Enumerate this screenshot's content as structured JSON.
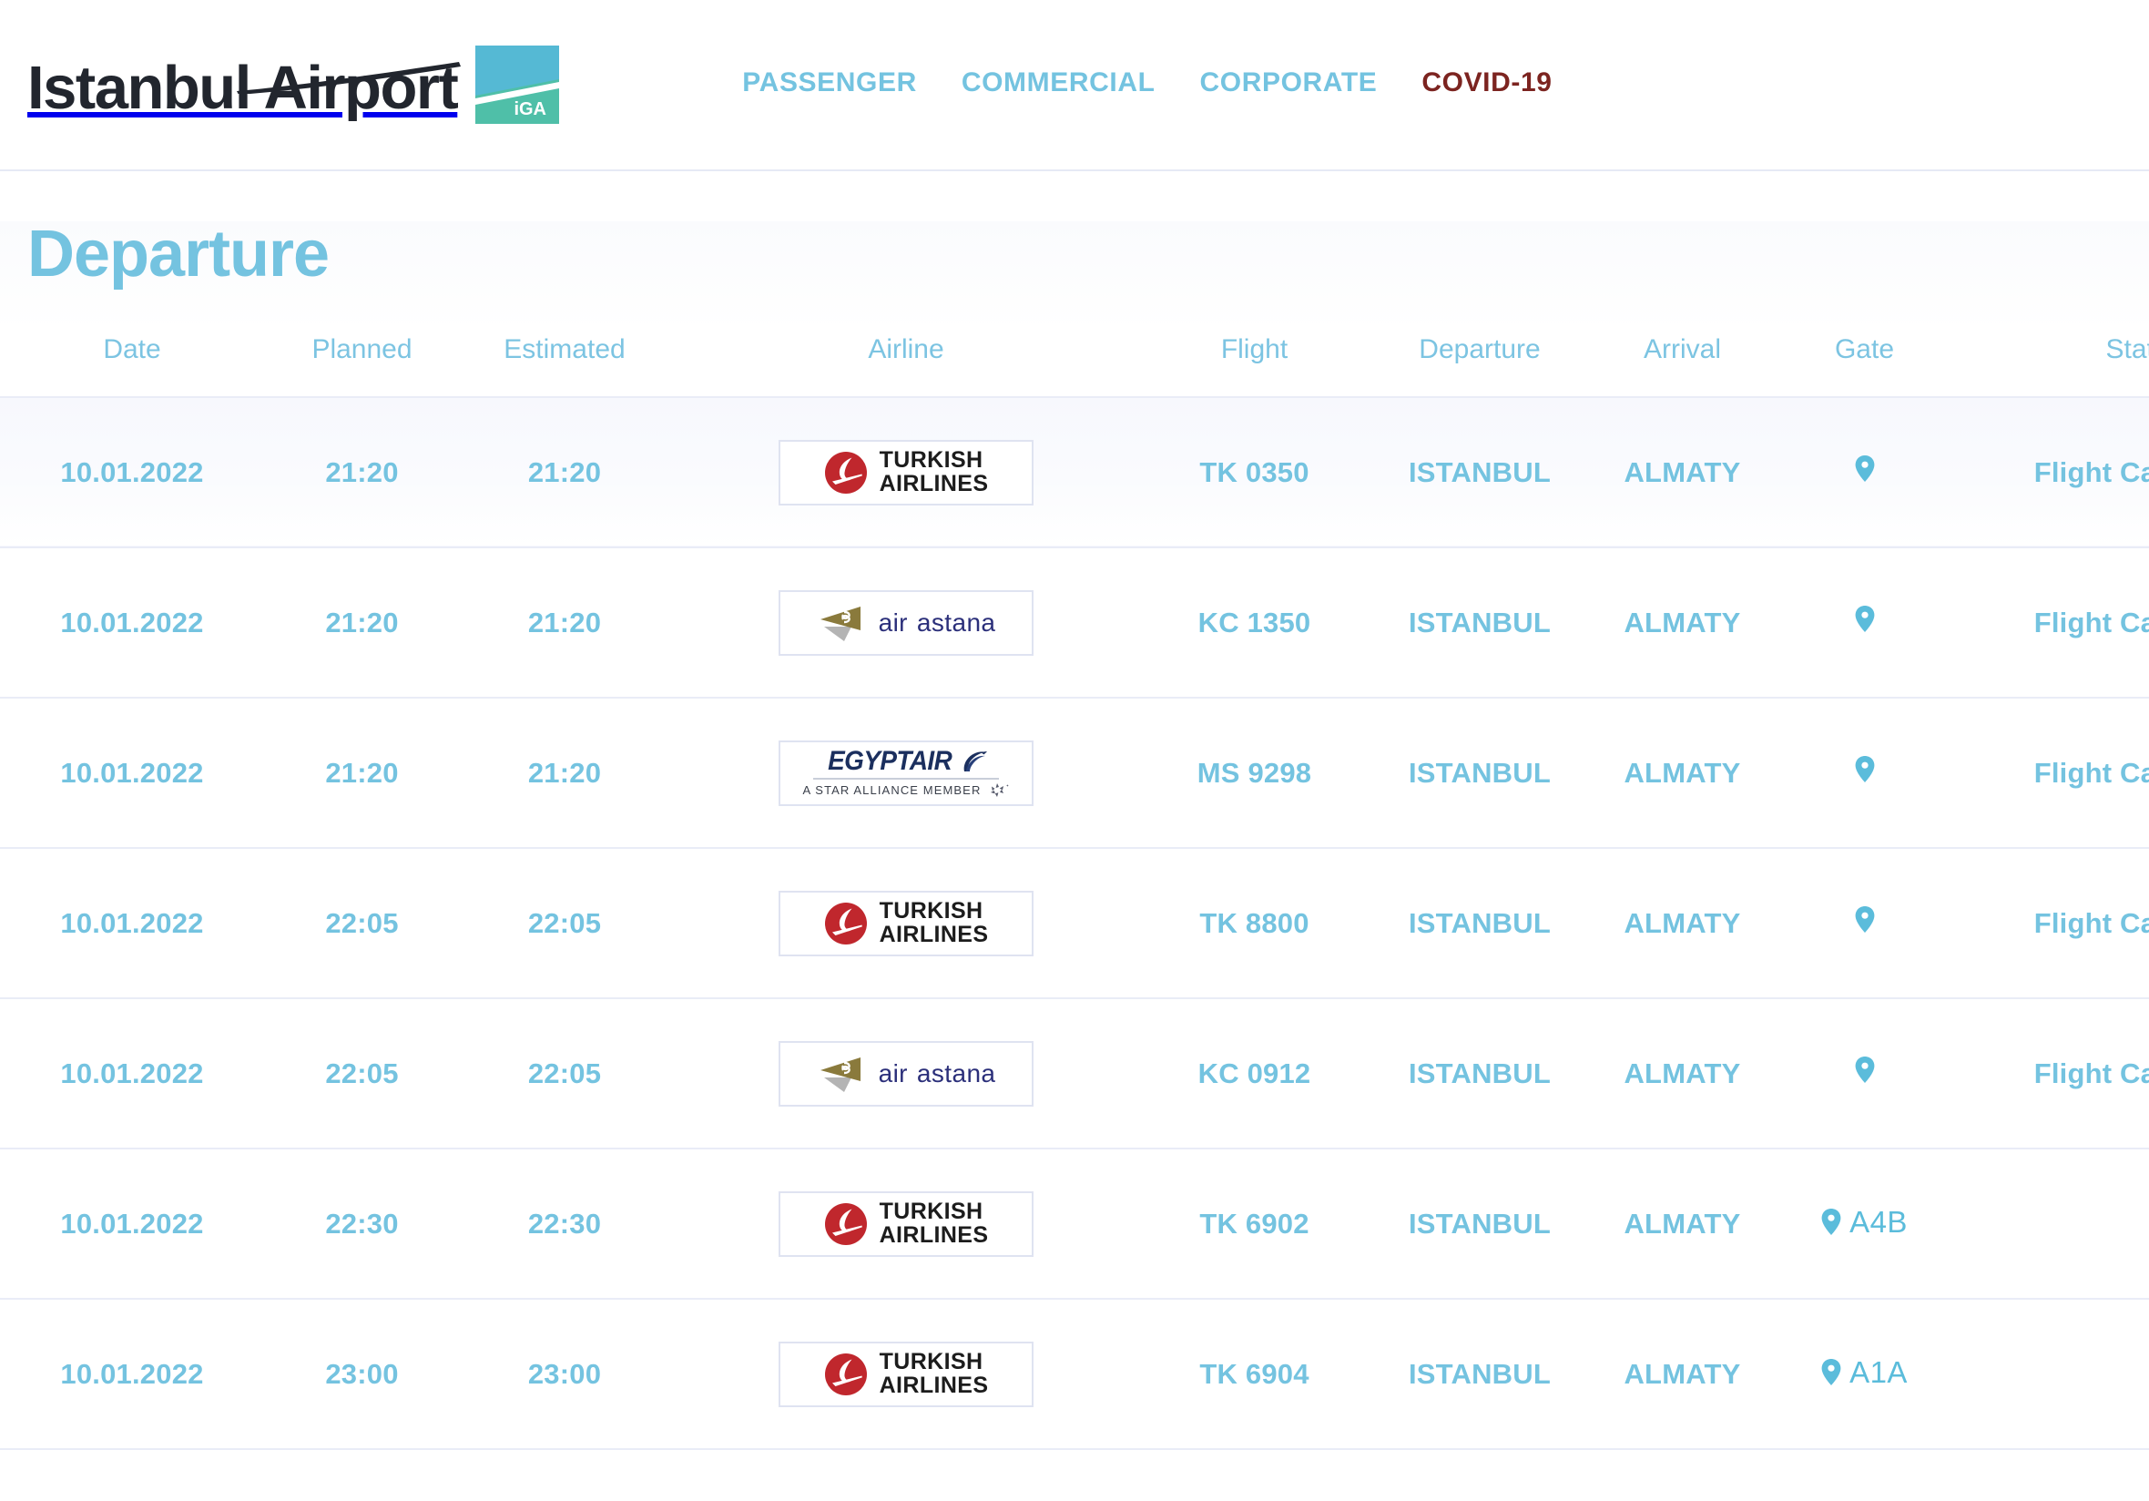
{
  "header": {
    "brand_name": "Istanbul Airport",
    "brand_mark_label": "iGA",
    "nav": [
      {
        "label": "PASSENGER",
        "name": "nav-passenger",
        "variant": "default"
      },
      {
        "label": "COMMERCIAL",
        "name": "nav-commercial",
        "variant": "default"
      },
      {
        "label": "CORPORATE",
        "name": "nav-corporate",
        "variant": "default"
      },
      {
        "label": "COVID-19",
        "name": "nav-covid-19",
        "variant": "covid"
      }
    ]
  },
  "page": {
    "title": "Departure"
  },
  "table": {
    "columns": [
      {
        "label": "Date",
        "key": "date"
      },
      {
        "label": "Planned",
        "key": "planned"
      },
      {
        "label": "Estimated",
        "key": "estimated"
      },
      {
        "label": "Airline",
        "key": "airline"
      },
      {
        "label": "Flight",
        "key": "flight"
      },
      {
        "label": "Departure",
        "key": "departure"
      },
      {
        "label": "Arrival",
        "key": "arrival"
      },
      {
        "label": "Gate",
        "key": "gate"
      },
      {
        "label": "Status",
        "key": "status"
      }
    ],
    "rows": [
      {
        "date": "10.01.2022",
        "planned": "21:20",
        "estimated": "21:20",
        "airline": "Turkish Airlines",
        "airline_logo": "turkish-airlines-logo",
        "flight": "TK 0350",
        "departure": "ISTANBUL",
        "arrival": "ALMATY",
        "gate": "",
        "status": "Flight Cancelled",
        "highlighted": true
      },
      {
        "date": "10.01.2022",
        "planned": "21:20",
        "estimated": "21:20",
        "airline": "Air Astana",
        "airline_logo": "air-astana-logo",
        "flight": "KC 1350",
        "departure": "ISTANBUL",
        "arrival": "ALMATY",
        "gate": "",
        "status": "Flight Cancelled",
        "highlighted": false
      },
      {
        "date": "10.01.2022",
        "planned": "21:20",
        "estimated": "21:20",
        "airline": "EgyptAir",
        "airline_logo": "egyptair-logo",
        "flight": "MS 9298",
        "departure": "ISTANBUL",
        "arrival": "ALMATY",
        "gate": "",
        "status": "Flight Cancelled",
        "highlighted": false
      },
      {
        "date": "10.01.2022",
        "planned": "22:05",
        "estimated": "22:05",
        "airline": "Turkish Airlines",
        "airline_logo": "turkish-airlines-logo",
        "flight": "TK 8800",
        "departure": "ISTANBUL",
        "arrival": "ALMATY",
        "gate": "",
        "status": "Flight Cancelled",
        "highlighted": false
      },
      {
        "date": "10.01.2022",
        "planned": "22:05",
        "estimated": "22:05",
        "airline": "Air Astana",
        "airline_logo": "air-astana-logo",
        "flight": "KC 0912",
        "departure": "ISTANBUL",
        "arrival": "ALMATY",
        "gate": "",
        "status": "Flight Cancelled",
        "highlighted": false
      },
      {
        "date": "10.01.2022",
        "planned": "22:30",
        "estimated": "22:30",
        "airline": "Turkish Airlines",
        "airline_logo": "turkish-airlines-logo",
        "flight": "TK 6902",
        "departure": "ISTANBUL",
        "arrival": "ALMATY",
        "gate": "A4B",
        "status": "",
        "highlighted": false
      },
      {
        "date": "10.01.2022",
        "planned": "23:00",
        "estimated": "23:00",
        "airline": "Turkish Airlines",
        "airline_logo": "turkish-airlines-logo",
        "flight": "TK 6904",
        "departure": "ISTANBUL",
        "arrival": "ALMATY",
        "gate": "A1A",
        "status": "",
        "highlighted": false
      }
    ]
  },
  "logos": {
    "turkish_airlines": {
      "line1": "TURKISH",
      "line2": "AIRLINES"
    },
    "air_astana": {
      "word1": "air",
      "word2": "astana"
    },
    "egyptair": {
      "word": "EGYPTAIR",
      "subtitle": "A STAR ALLIANCE MEMBER"
    }
  },
  "colors": {
    "accent": "#74c3e0",
    "covid": "#7c2420",
    "border": "#e9ecf7",
    "iga_top": "#55b9d4",
    "iga_bottom": "#4fbfa8",
    "turkish_red": "#c0272d",
    "astana_gold": "#8a7a3c",
    "egyptair_navy": "#1b2f5e"
  }
}
